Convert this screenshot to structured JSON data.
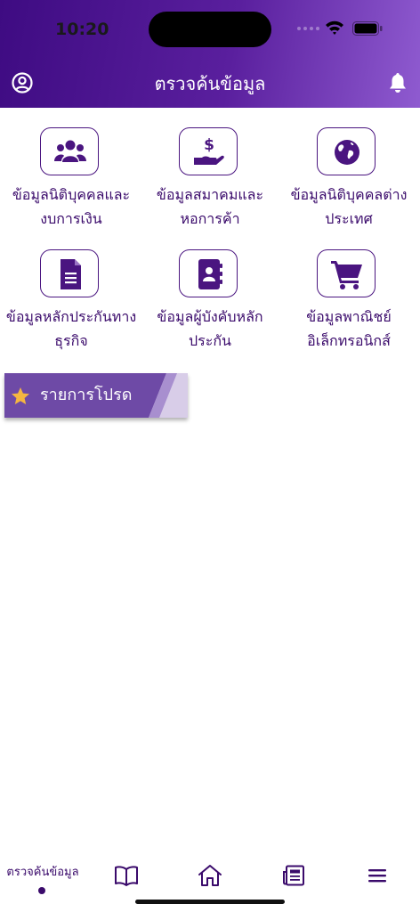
{
  "status_bar": {
    "time": "10:20"
  },
  "header": {
    "title": "ตรวจค้นข้อมูล"
  },
  "menu": [
    {
      "label": "ข้อมูลนิติบุคคลและ\nงบการเงิน",
      "icon": "users-group-icon"
    },
    {
      "label": "ข้อมูลสมาคมและ\nหอการค้า",
      "icon": "hand-dollar-icon"
    },
    {
      "label": "ข้อมูลนิติบุคคลต่าง\nประเทศ",
      "icon": "globe-icon"
    },
    {
      "label": "ข้อมูลหลักประกันทาง\nธุรกิจ",
      "icon": "document-icon"
    },
    {
      "label": "ข้อมูลผู้บังคับหลัก\nประกัน",
      "icon": "contact-book-icon"
    },
    {
      "label": "ข้อมูลพาณิชย์\nอิเล็กทรอนิกส์",
      "icon": "shopping-cart-icon"
    }
  ],
  "favorites": {
    "label": "รายการโปรด",
    "icon": "star-icon"
  },
  "tabbar": {
    "active_label": "ตรวจค้นข้อมูล",
    "tabs": [
      "search-data",
      "book-icon",
      "home-icon",
      "news-icon",
      "menu-icon"
    ]
  },
  "colors": {
    "primary": "#4a1580",
    "header_start": "#3e0b82",
    "header_end": "#8f5bd0",
    "star": "#f5b640"
  }
}
